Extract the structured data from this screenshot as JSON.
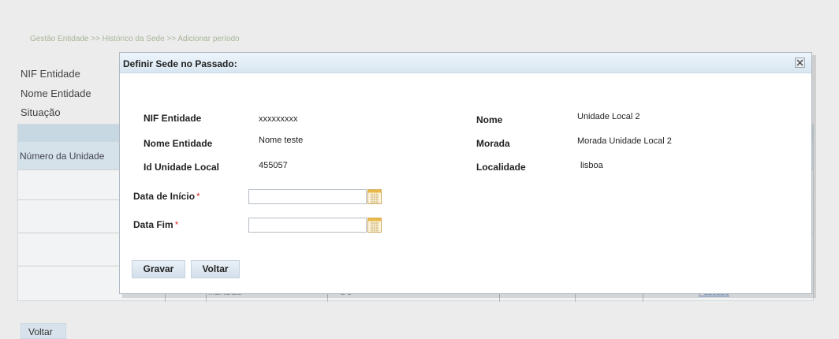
{
  "breadcrumb": "Gestão Entidade >> Histórico da Sede >> Adicionar período",
  "background": {
    "labels": {
      "nif": "NIF Entidade",
      "nome": "Nome Entidade",
      "situacao": "Situação"
    },
    "table": {
      "column_header": "Número da Unidade",
      "partial_cell_1": "MENDES",
      "partial_cell_2": "2 3",
      "partial_link": "Passado"
    },
    "voltar_label": "Voltar"
  },
  "dialog": {
    "title": "Definir Sede no Passado:",
    "info": {
      "nif_label": "NIF Entidade",
      "nif_value": "xxxxxxxxx",
      "nome_entidade_label": "Nome Entidade",
      "nome_entidade_value": "Nome teste",
      "id_unidade_label": "Id Unidade Local",
      "id_unidade_value": "455057",
      "nome_label": "Nome",
      "nome_value": "Unidade Local 2",
      "morada_label": "Morada",
      "morada_value": "Morada Unidade Local 2",
      "localidade_label": "Localidade",
      "localidade_value": "lisboa"
    },
    "form": {
      "data_inicio_label": "Data de Início",
      "data_inicio_value": "",
      "data_fim_label": "Data Fim",
      "data_fim_value": "",
      "required_marker": "*"
    },
    "buttons": {
      "gravar": "Gravar",
      "voltar": "Voltar"
    }
  },
  "colors": {
    "dialog_title_bg": "#d8e6f1",
    "button_bg": "#d3dfea",
    "required": "#dd3333",
    "breadcrumb": "#a9b59a"
  }
}
